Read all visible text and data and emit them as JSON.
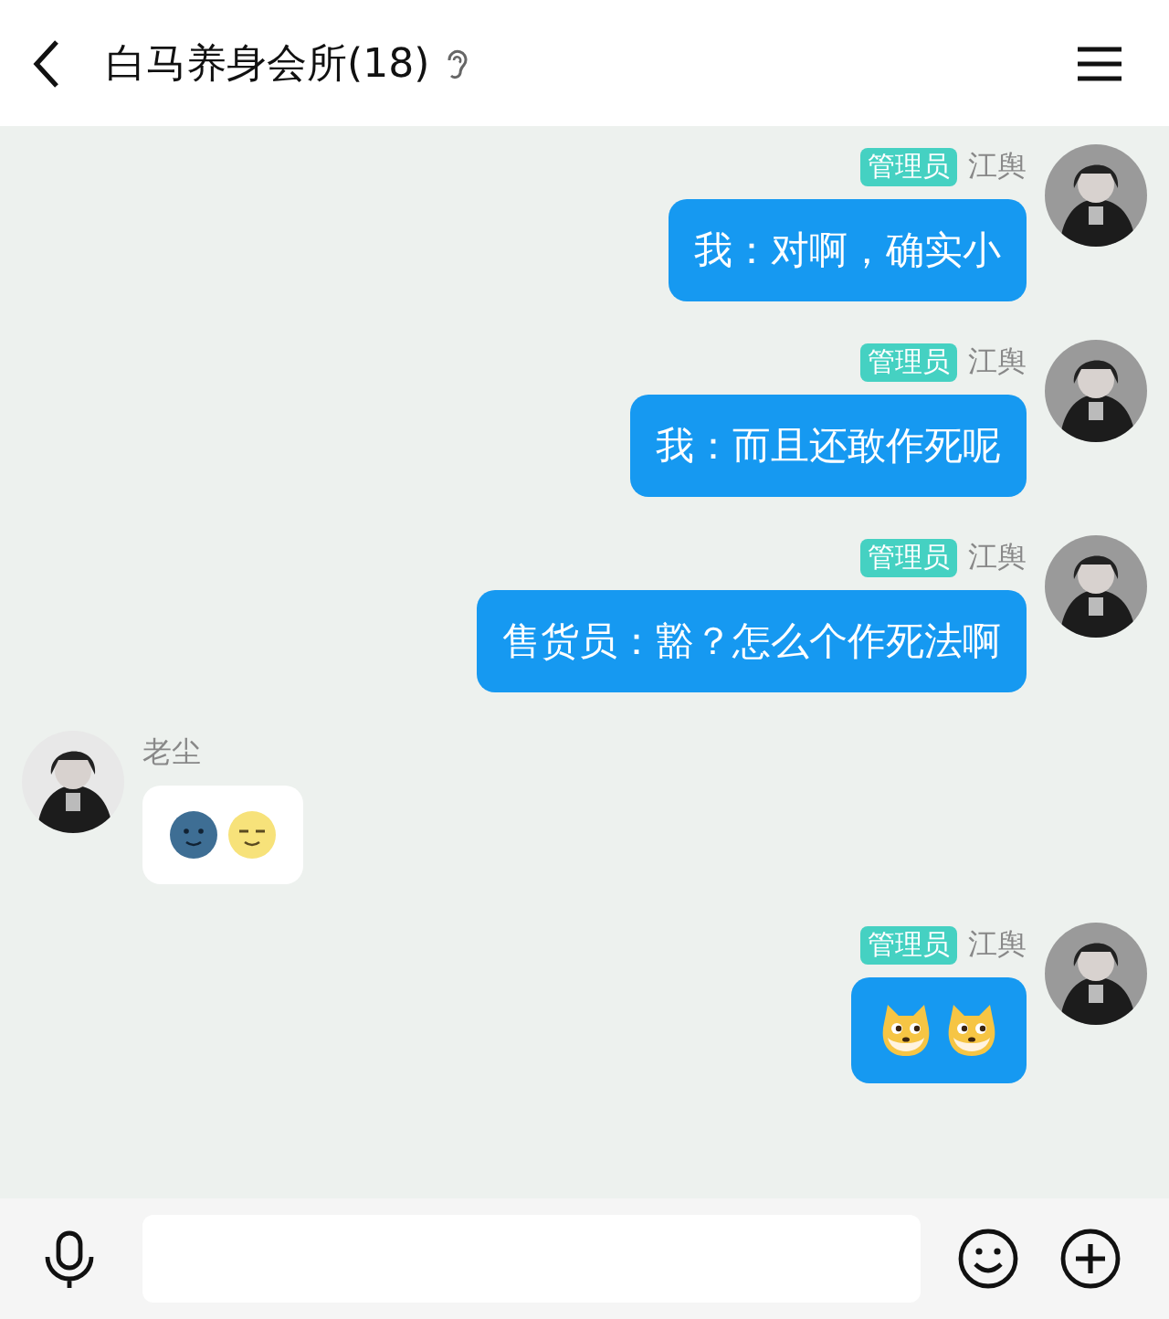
{
  "header": {
    "title": "白马养身会所(18)"
  },
  "messages": [
    {
      "outgoing": true,
      "badge": "管理员",
      "sender": "江舆",
      "kind": "text",
      "text": "我：对啊，确实小"
    },
    {
      "outgoing": true,
      "badge": "管理员",
      "sender": "江舆",
      "kind": "text",
      "text": "我：而且还敢作死呢"
    },
    {
      "outgoing": true,
      "badge": "管理员",
      "sender": "江舆",
      "kind": "text",
      "text": "售货员：豁？怎么个作死法啊"
    },
    {
      "outgoing": false,
      "sender": "老尘",
      "kind": "emoji",
      "emojis": [
        {
          "kind": "dark-moon"
        },
        {
          "kind": "bright-moon"
        }
      ]
    },
    {
      "outgoing": true,
      "badge": "管理员",
      "sender": "江舆",
      "kind": "emoji",
      "emojis": [
        {
          "kind": "dog"
        },
        {
          "kind": "dog"
        }
      ]
    }
  ]
}
